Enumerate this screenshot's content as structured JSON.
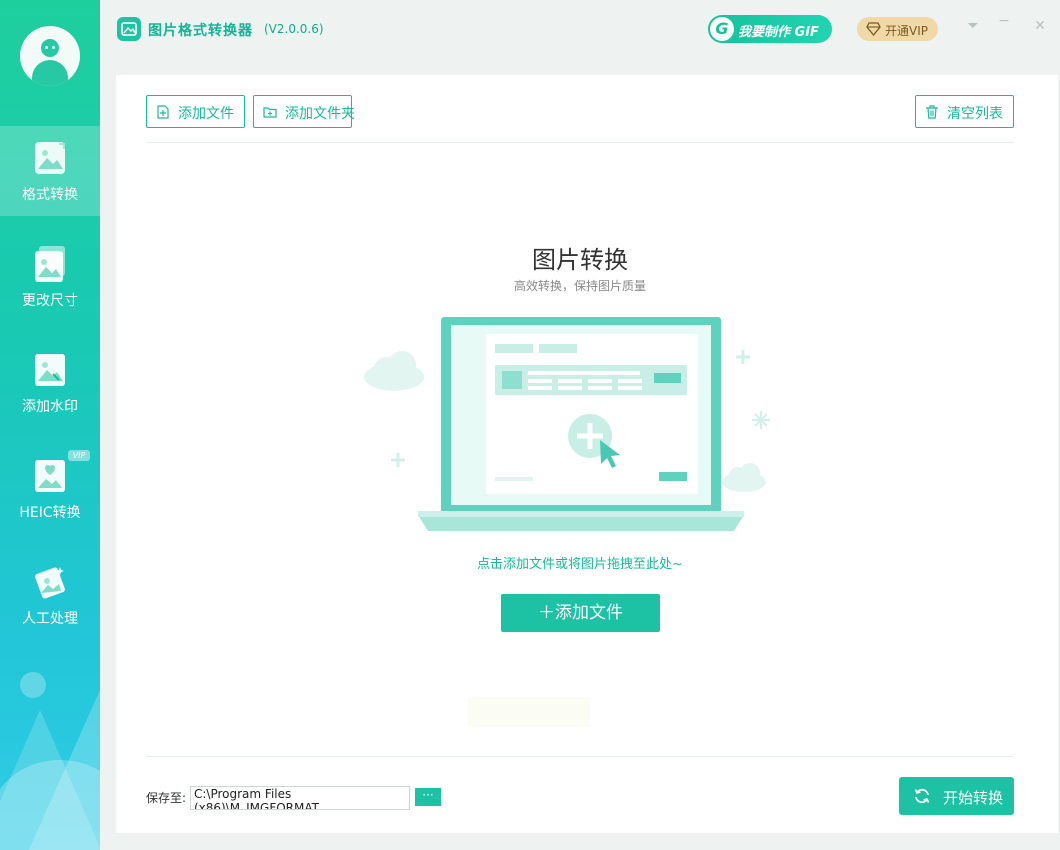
{
  "app": {
    "name": "图片格式转换器",
    "version": "(V2.0.0.6)"
  },
  "titlebar": {
    "gif_button_label": "我要制作 GIF",
    "gif_button_glyph": "G",
    "vip_button_label": "开通VIP",
    "dropdown_glyph": "⏷",
    "minimize_glyph": "−",
    "close_glyph": "✕"
  },
  "sidebar": {
    "items": [
      {
        "label": "格式转换",
        "icon": "image-convert-icon",
        "active": true
      },
      {
        "label": "更改尺寸",
        "icon": "image-resize-icon",
        "active": false
      },
      {
        "label": "添加水印",
        "icon": "image-watermark-icon",
        "active": false
      },
      {
        "label": "HEIC转换",
        "icon": "heic-convert-icon",
        "active": false,
        "badge": "VIP"
      },
      {
        "label": "人工处理",
        "icon": "manual-process-icon",
        "active": false
      }
    ]
  },
  "toolbar": {
    "add_file_label": "添加文件",
    "add_folder_label": "添加文件夹",
    "clear_list_label": "清空列表"
  },
  "main": {
    "title": "图片转换",
    "subtitle": "高效转换，保持图片质量",
    "hint": "点击添加文件或将图片拖拽至此处~",
    "add_button_label": "＋添加文件"
  },
  "footer": {
    "save_label": "保存至:",
    "save_path": "C:\\Program Files (x86)\\M_IMGFORMAT",
    "browse_label": "···",
    "start_label": "开始转换"
  },
  "colors": {
    "accent": "#1cc2a3",
    "sidebar_top": "#1ecf9e",
    "sidebar_bottom": "#30cce6",
    "vip_gold": "#f0d9a6"
  }
}
